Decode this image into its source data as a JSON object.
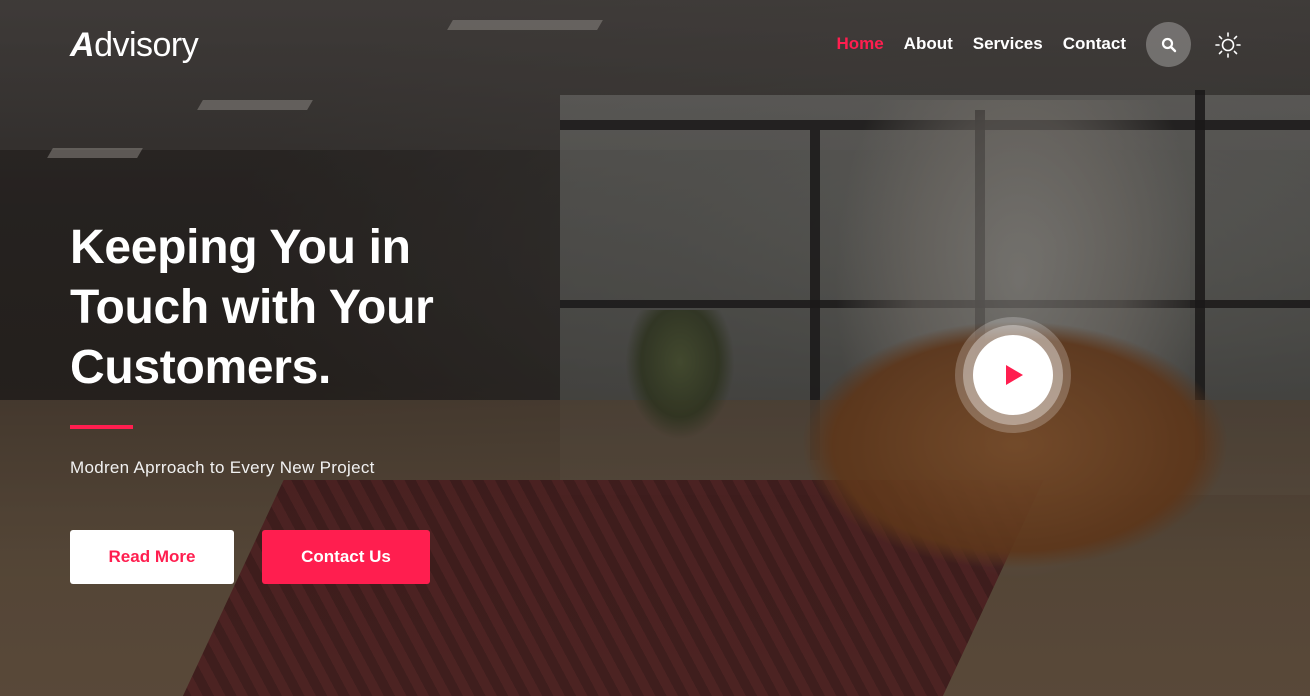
{
  "brand": {
    "logo_initial": "A",
    "logo_rest": "dvisory"
  },
  "nav": {
    "items": [
      {
        "label": "Home",
        "active": true
      },
      {
        "label": "About",
        "active": false
      },
      {
        "label": "Services",
        "active": false
      },
      {
        "label": "Contact",
        "active": false
      }
    ],
    "search_icon": "search-icon",
    "theme_icon": "sun-icon"
  },
  "hero": {
    "title_line1": "Keeping You in",
    "title_line2": "Touch with Your",
    "title_line3": "Customers.",
    "subtitle": "Modren Aprroach to Every New Project",
    "primary_button": "Read More",
    "secondary_button": "Contact Us",
    "video_icon": "play-icon"
  },
  "colors": {
    "accent": "#ff1e4f",
    "text": "#ffffff"
  }
}
